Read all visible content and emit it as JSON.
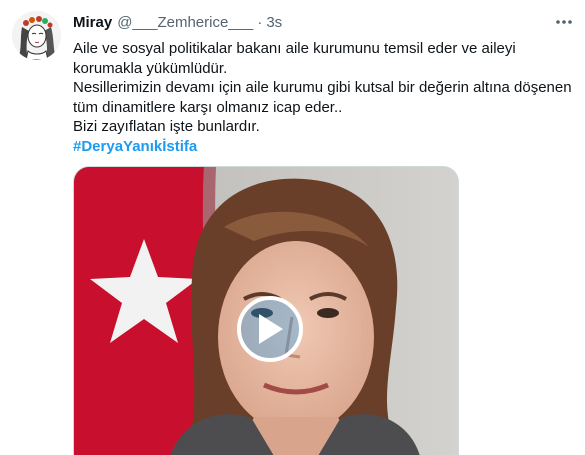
{
  "tweet": {
    "display_name": "Miray",
    "handle": "@___Zemherice___",
    "separator": "·",
    "time": "3s",
    "lines": [
      "Aile ve sosyal politikalar bakanı aile kurumunu temsil eder ve aileyi",
      "korumakla yükümlüdür.",
      "Nesillerimizin devamı için aile kurumu gibi kutsal bir değerin altına döşenen",
      "tüm dinamitlere karşı olmanız icap eder..",
      "Bizi zayıflatan işte bunlardır."
    ],
    "hashtag": "#DeryaYanıkİstifa"
  },
  "icons": {
    "more": "more-dots-icon",
    "play": "play-icon"
  },
  "colors": {
    "link": "#1d9bf0",
    "text": "#0f1419",
    "secondary": "#536471",
    "flag_red": "#c8102e"
  }
}
